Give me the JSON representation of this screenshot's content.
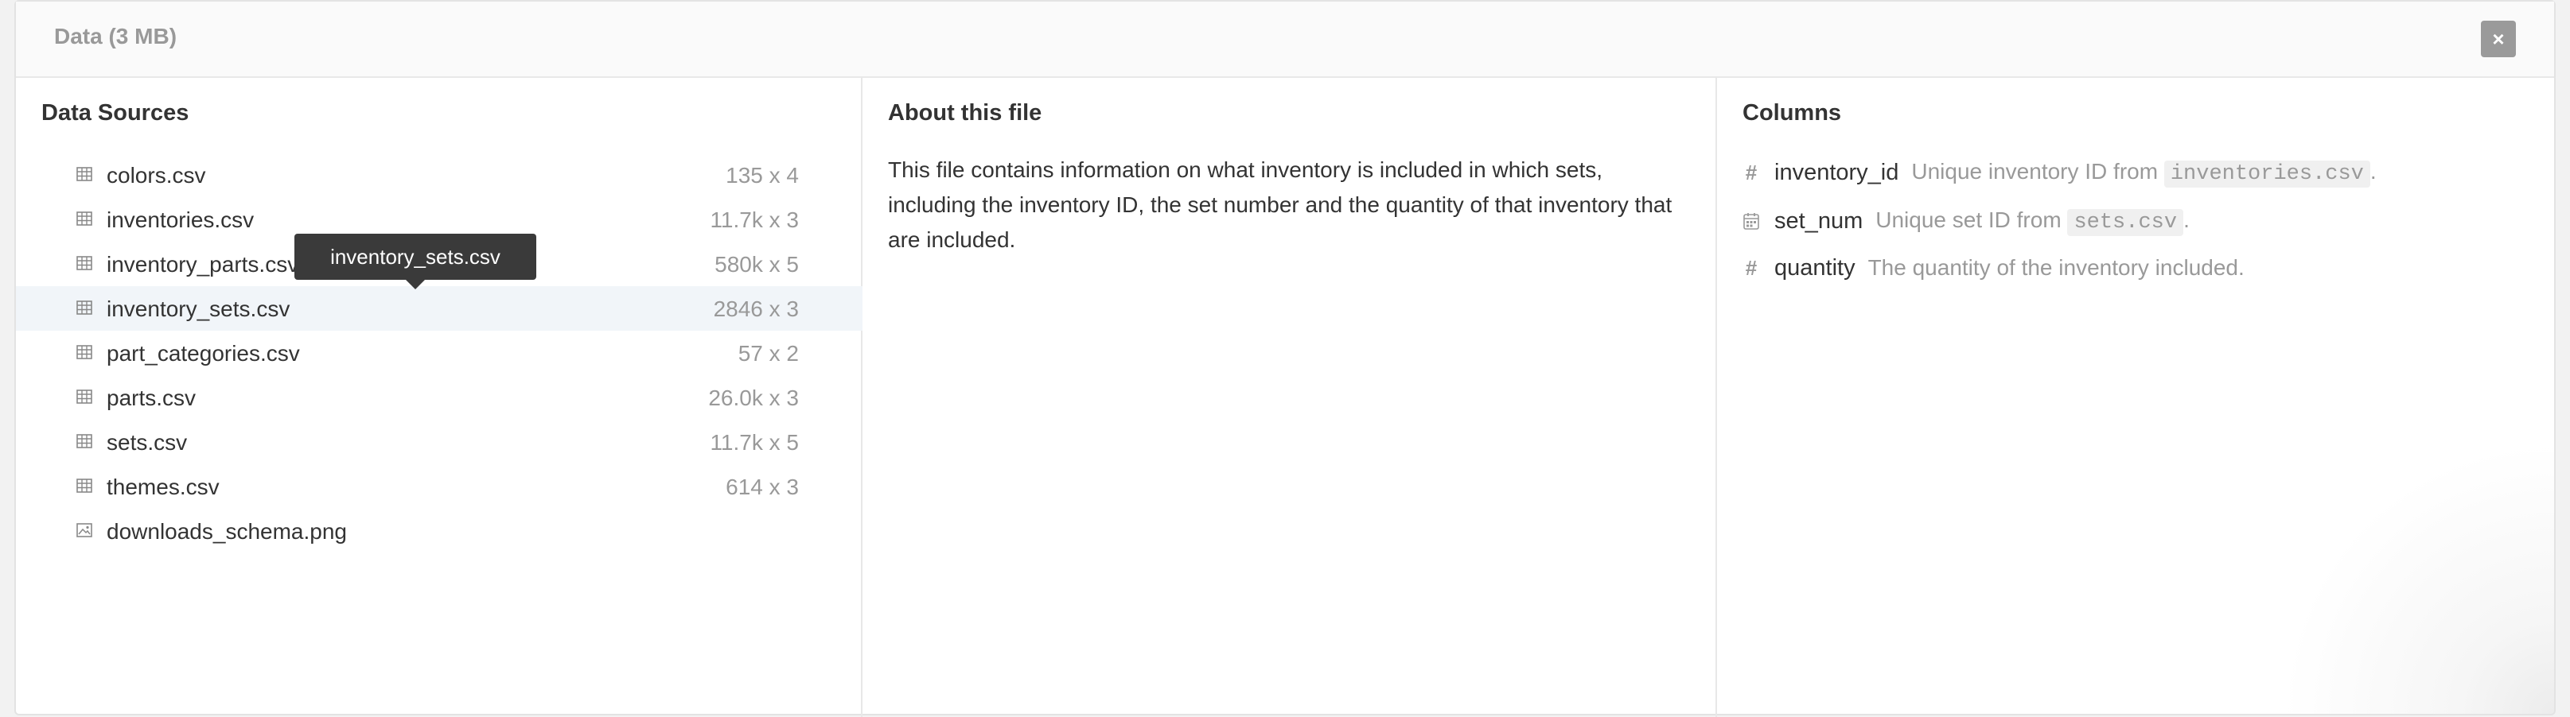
{
  "panel": {
    "title": "Data (3 MB)",
    "close_icon": "×"
  },
  "sources": {
    "heading": "Data Sources",
    "files": [
      {
        "name": "colors.csv",
        "dims": "135 x 4",
        "icon": "table-icon"
      },
      {
        "name": "inventories.csv",
        "dims": "11.7k x 3",
        "icon": "table-icon"
      },
      {
        "name": "inventory_parts.csv",
        "dims": "580k x 5",
        "icon": "table-icon"
      },
      {
        "name": "inventory_sets.csv",
        "dims": "2846 x 3",
        "icon": "table-icon",
        "active": true
      },
      {
        "name": "part_categories.csv",
        "dims": "57 x 2",
        "icon": "table-icon"
      },
      {
        "name": "parts.csv",
        "dims": "26.0k x 3",
        "icon": "table-icon"
      },
      {
        "name": "sets.csv",
        "dims": "11.7k x 5",
        "icon": "table-icon"
      },
      {
        "name": "themes.csv",
        "dims": "614 x 3",
        "icon": "table-icon"
      },
      {
        "name": "downloads_schema.png",
        "dims": "",
        "icon": "image-icon"
      }
    ],
    "tooltip": "inventory_sets.csv"
  },
  "about": {
    "heading": "About this file",
    "text": "This file contains information on what inventory is included in which sets, including the inventory ID, the set number and the quantity of that inventory that are included."
  },
  "columns": {
    "heading": "Columns",
    "items": [
      {
        "type_icon": "hash-icon",
        "name": "inventory_id",
        "desc_prefix": "Unique inventory ID from ",
        "desc_code": "inventories.csv",
        "desc_suffix": "."
      },
      {
        "type_icon": "calendar-icon",
        "name": "set_num",
        "desc_prefix": "Unique set ID from ",
        "desc_code": "sets.csv",
        "desc_suffix": "."
      },
      {
        "type_icon": "hash-icon",
        "name": "quantity",
        "desc_prefix": "The quantity of the inventory included.",
        "desc_code": "",
        "desc_suffix": ""
      }
    ]
  }
}
